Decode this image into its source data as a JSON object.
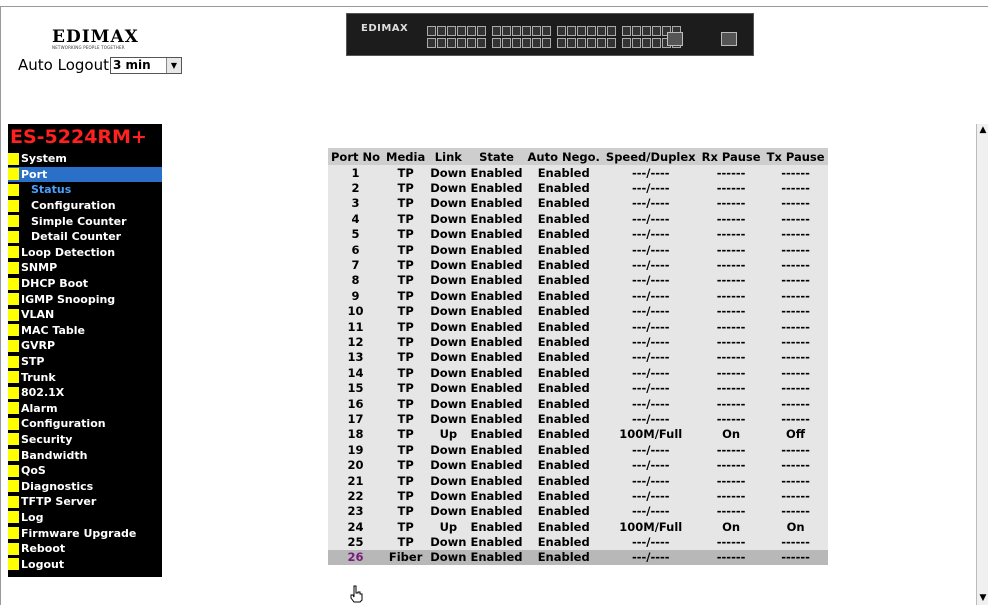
{
  "brand": {
    "logo_text": "EDIMAX",
    "logo_tagline": "NETWORKING PEOPLE TOGETHER",
    "device_label": "EDIMAX"
  },
  "auto_logout": {
    "label": "Auto Logout",
    "value": "3 min"
  },
  "sidebar": {
    "model": "ES-5224RM+",
    "items": [
      {
        "label": "System"
      },
      {
        "label": "Port"
      },
      {
        "label": "Status",
        "sub": true
      },
      {
        "label": "Configuration",
        "sub": true
      },
      {
        "label": "Simple Counter",
        "sub": true
      },
      {
        "label": "Detail Counter",
        "sub": true
      },
      {
        "label": "Loop Detection"
      },
      {
        "label": "SNMP"
      },
      {
        "label": "DHCP Boot"
      },
      {
        "label": "IGMP Snooping"
      },
      {
        "label": "VLAN"
      },
      {
        "label": "MAC Table"
      },
      {
        "label": "GVRP"
      },
      {
        "label": "STP"
      },
      {
        "label": "Trunk"
      },
      {
        "label": "802.1X"
      },
      {
        "label": "Alarm"
      },
      {
        "label": "Configuration"
      },
      {
        "label": "Security"
      },
      {
        "label": "Bandwidth"
      },
      {
        "label": "QoS"
      },
      {
        "label": "Diagnostics"
      },
      {
        "label": "TFTP Server"
      },
      {
        "label": "Log"
      },
      {
        "label": "Firmware Upgrade"
      },
      {
        "label": "Reboot"
      },
      {
        "label": "Logout"
      }
    ]
  },
  "table": {
    "headers": [
      "Port No",
      "Media",
      "Link",
      "State",
      "Auto Nego.",
      "Speed/Duplex",
      "Rx Pause",
      "Tx Pause"
    ],
    "rows": [
      [
        "1",
        "TP",
        "Down",
        "Enabled",
        "Enabled",
        "---/----",
        "------",
        "------"
      ],
      [
        "2",
        "TP",
        "Down",
        "Enabled",
        "Enabled",
        "---/----",
        "------",
        "------"
      ],
      [
        "3",
        "TP",
        "Down",
        "Enabled",
        "Enabled",
        "---/----",
        "------",
        "------"
      ],
      [
        "4",
        "TP",
        "Down",
        "Enabled",
        "Enabled",
        "---/----",
        "------",
        "------"
      ],
      [
        "5",
        "TP",
        "Down",
        "Enabled",
        "Enabled",
        "---/----",
        "------",
        "------"
      ],
      [
        "6",
        "TP",
        "Down",
        "Enabled",
        "Enabled",
        "---/----",
        "------",
        "------"
      ],
      [
        "7",
        "TP",
        "Down",
        "Enabled",
        "Enabled",
        "---/----",
        "------",
        "------"
      ],
      [
        "8",
        "TP",
        "Down",
        "Enabled",
        "Enabled",
        "---/----",
        "------",
        "------"
      ],
      [
        "9",
        "TP",
        "Down",
        "Enabled",
        "Enabled",
        "---/----",
        "------",
        "------"
      ],
      [
        "10",
        "TP",
        "Down",
        "Enabled",
        "Enabled",
        "---/----",
        "------",
        "------"
      ],
      [
        "11",
        "TP",
        "Down",
        "Enabled",
        "Enabled",
        "---/----",
        "------",
        "------"
      ],
      [
        "12",
        "TP",
        "Down",
        "Enabled",
        "Enabled",
        "---/----",
        "------",
        "------"
      ],
      [
        "13",
        "TP",
        "Down",
        "Enabled",
        "Enabled",
        "---/----",
        "------",
        "------"
      ],
      [
        "14",
        "TP",
        "Down",
        "Enabled",
        "Enabled",
        "---/----",
        "------",
        "------"
      ],
      [
        "15",
        "TP",
        "Down",
        "Enabled",
        "Enabled",
        "---/----",
        "------",
        "------"
      ],
      [
        "16",
        "TP",
        "Down",
        "Enabled",
        "Enabled",
        "---/----",
        "------",
        "------"
      ],
      [
        "17",
        "TP",
        "Down",
        "Enabled",
        "Enabled",
        "---/----",
        "------",
        "------"
      ],
      [
        "18",
        "TP",
        "Up",
        "Enabled",
        "Enabled",
        "100M/Full",
        "On",
        "Off"
      ],
      [
        "19",
        "TP",
        "Down",
        "Enabled",
        "Enabled",
        "---/----",
        "------",
        "------"
      ],
      [
        "20",
        "TP",
        "Down",
        "Enabled",
        "Enabled",
        "---/----",
        "------",
        "------"
      ],
      [
        "21",
        "TP",
        "Down",
        "Enabled",
        "Enabled",
        "---/----",
        "------",
        "------"
      ],
      [
        "22",
        "TP",
        "Down",
        "Enabled",
        "Enabled",
        "---/----",
        "------",
        "------"
      ],
      [
        "23",
        "TP",
        "Down",
        "Enabled",
        "Enabled",
        "---/----",
        "------",
        "------"
      ],
      [
        "24",
        "TP",
        "Up",
        "Enabled",
        "Enabled",
        "100M/Full",
        "On",
        "On"
      ],
      [
        "25",
        "TP",
        "Down",
        "Enabled",
        "Enabled",
        "---/----",
        "------",
        "------"
      ],
      [
        "26",
        "Fiber",
        "Down",
        "Enabled",
        "Enabled",
        "---/----",
        "------",
        "------"
      ]
    ]
  },
  "icons": {
    "scroll_up": "arrow-up-icon",
    "scroll_down": "arrow-down-icon",
    "cursor": "hand-pointer-icon"
  }
}
